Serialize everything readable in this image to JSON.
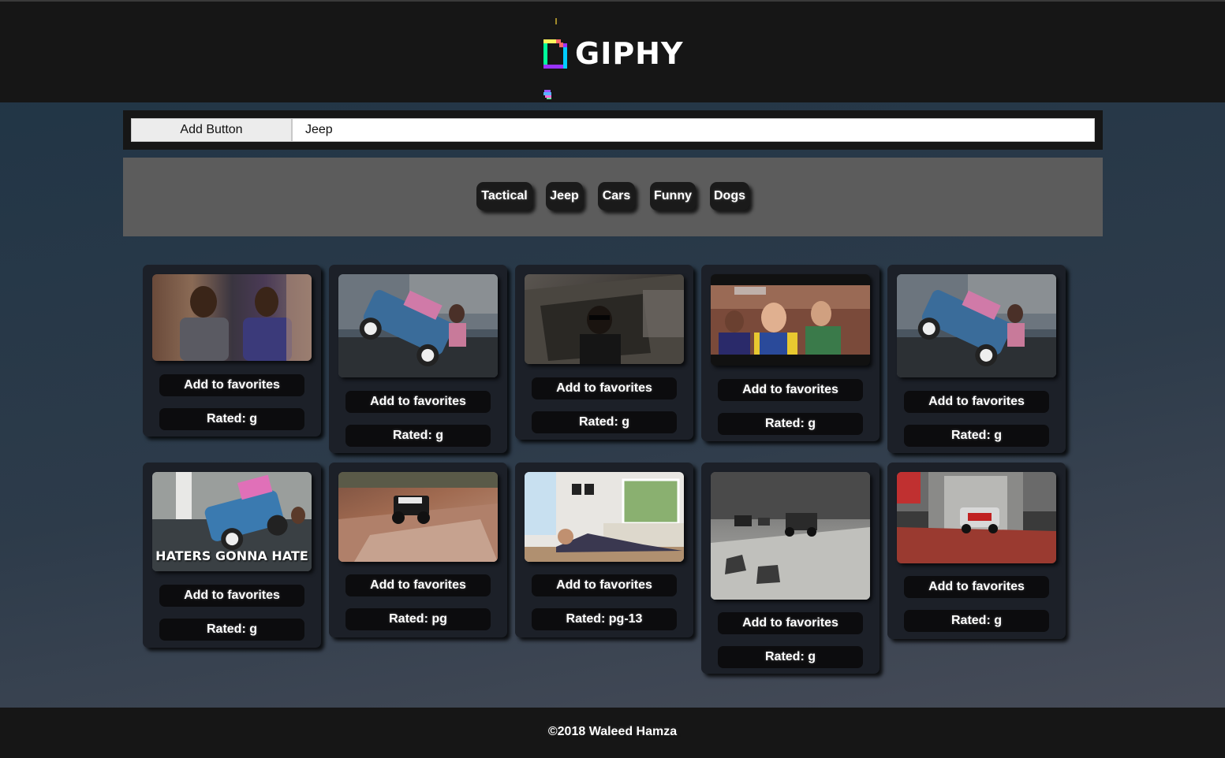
{
  "header": {
    "logo_text": "GIPHY"
  },
  "add_form": {
    "button_label": "Add Button",
    "input_value": "Jeep"
  },
  "topics": [
    "Tactical",
    "Jeep",
    "Cars",
    "Funny",
    "Dogs"
  ],
  "cards": [
    {
      "favorite_label": "Add to favorites",
      "rating": "Rated: g"
    },
    {
      "favorite_label": "Add to favorites",
      "rating": "Rated: g"
    },
    {
      "favorite_label": "Add to favorites",
      "rating": "Rated: g"
    },
    {
      "favorite_label": "Add to favorites",
      "rating": "Rated: g"
    },
    {
      "favorite_label": "Add to favorites",
      "rating": "Rated: g"
    },
    {
      "favorite_label": "Add to favorites",
      "rating": "Rated: g",
      "caption": "HATERS GONNA HATE"
    },
    {
      "favorite_label": "Add to favorites",
      "rating": "Rated: pg"
    },
    {
      "favorite_label": "Add to favorites",
      "rating": "Rated: pg-13"
    },
    {
      "favorite_label": "Add to favorites",
      "rating": "Rated: g"
    },
    {
      "favorite_label": "Add to favorites",
      "rating": "Rated: g"
    }
  ],
  "footer": {
    "copyright": "©2018 Waleed Hamza"
  }
}
